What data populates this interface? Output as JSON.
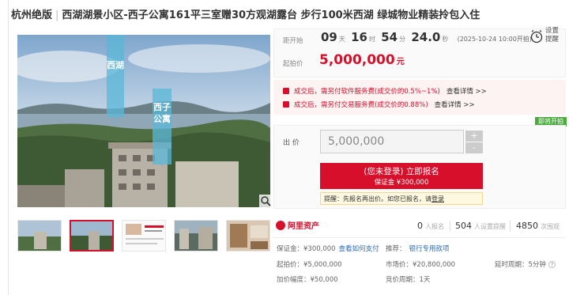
{
  "title": {
    "location": "杭州绝版",
    "headline": "西湖湖景小区-西子公寓161平三室赠30方观湖露台 步行100米西湖 绿城物业精装拎包入住"
  },
  "image_labels": {
    "lake": "西湖",
    "building": "西子公寓"
  },
  "countdown": {
    "label": "距开始",
    "days": "09",
    "days_unit": "天",
    "hours": "16",
    "hours_unit": "时",
    "minutes": "54",
    "minutes_unit": "分",
    "seconds": "24.0",
    "seconds_unit": "秒",
    "end_text": "(2025-10-24 10:00开拍)"
  },
  "remind": {
    "line1": "设置",
    "line2": "提醒"
  },
  "start_price": {
    "label": "起拍价",
    "value": "5,000,000",
    "unit": "元"
  },
  "fees": [
    {
      "text": "成交后，需另付软件服务费(成交价的0.5%~1%)",
      "link": "查看详情 >>"
    },
    {
      "text": "成交后，需另付交易服务费(成交价的0.88%)",
      "link": "查看详情 >>"
    }
  ],
  "status_badge": "即将开拍",
  "bid": {
    "label": "出  价",
    "value": "5,000,000",
    "plus": "+",
    "minus": "-",
    "button_line1": "(您未登录) 立即报名",
    "button_line2": "保证金 ¥300,000",
    "tip_prefix": "提醒：先报名再出价。如您已报名，请",
    "tip_link": "登录"
  },
  "platform": "阿里资产",
  "stats": [
    {
      "value": "0",
      "label": "人报名"
    },
    {
      "value": "504",
      "label": "人设置提醒"
    },
    {
      "value": "4850",
      "label": "次围观"
    }
  ],
  "info": {
    "deposit_label": "保证金：¥300,000",
    "deposit_link": "查看如何支付",
    "recommend_label": "推荐：",
    "recommend_link": "银行专用款项",
    "start_price_label": "起拍价：¥5,000,000",
    "market_price_label": "市场价：¥20,800,000",
    "delay_label": "延时周期：5分钟",
    "increment_label": "加价幅度：¥50,000",
    "bidding_cycle_label": "竞价周期：1天"
  },
  "colors": {
    "accent": "#d80f2a",
    "badge": "#4aaa3c",
    "link": "#2a6bbf"
  }
}
